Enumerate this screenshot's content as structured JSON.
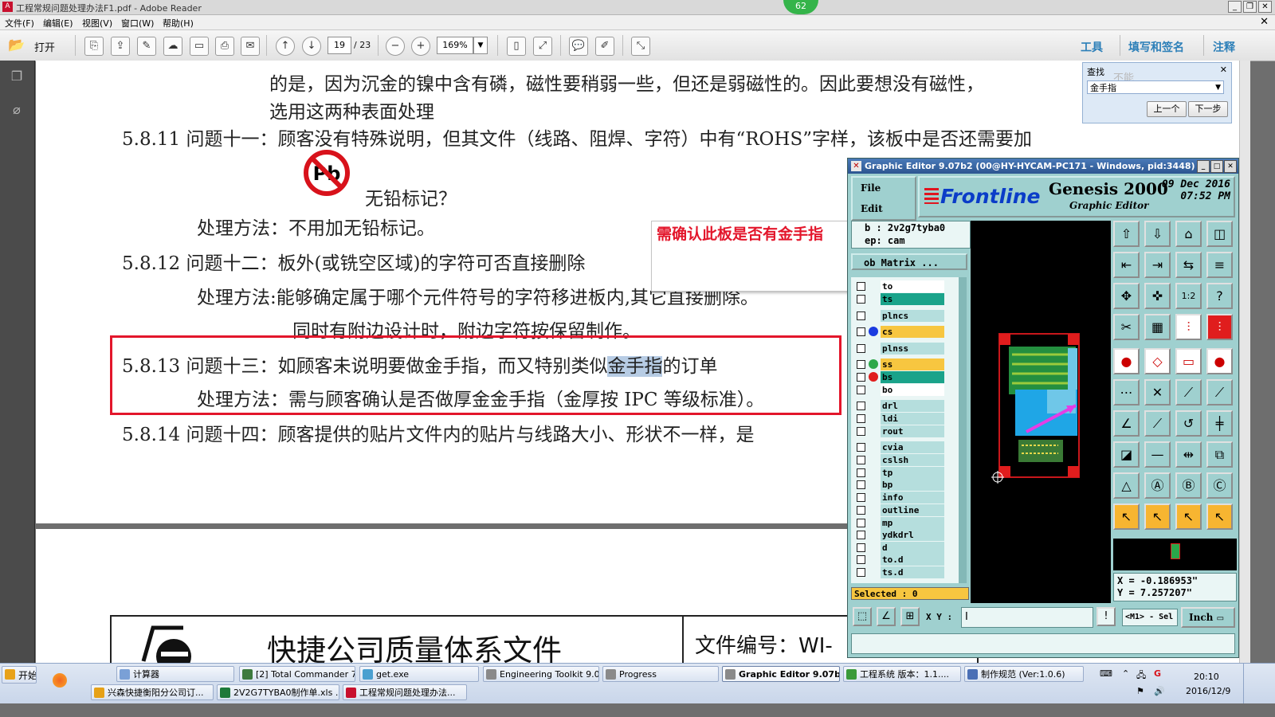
{
  "window": {
    "title": "工程常规问题处理办法F1.pdf - Adobe Reader",
    "badge": "62"
  },
  "menu": [
    "文件(F)",
    "编辑(E)",
    "视图(V)",
    "窗口(W)",
    "帮助(H)"
  ],
  "toolbar": {
    "open_label": "打开",
    "page_current": "19",
    "page_total": "/ 23",
    "zoom": "169%",
    "tools_label": "工具",
    "sign_label": "填写和签名",
    "comment_label": "注释"
  },
  "document": {
    "lines": [
      "的是，因为沉金的镍中含有磷，磁性要稍弱一些，但还是弱磁性的。因此要想没有磁性，",
      "选用这两种表面处理",
      "5.8.11 问题十一：顾客没有特殊说明，但其文件（线路、阻焊、字符）中有“ROHS”字样，该板中是否还需要加",
      "无铅标记？",
      "处理方法：不用加无铅标记。",
      "5.8.12 问题十二：板外(或铣空区域)的字符可否直接删除",
      "处理方法:能够确定属于哪个元件符号的字符移进板内,其它直接删除。",
      "同时有附边设计时，附边字符按保留制作。",
      "5.8.14 问题十四：顾客提供的贴片文件内的贴片与线路大小、形状不一样，是"
    ],
    "q13_prefix": "5.8.13 问题十三：如顾客未说明要做金手指，而又特别类似",
    "q13_highlight": "金手指",
    "q13_suffix": "的订单",
    "q13_method": "处理方法：需与顾客确认是否做厚金金手指（金厚按 IPC 等级标准）。",
    "footer_title": "快捷公司质量体系文件",
    "footer_docno": "文件编号：WI-",
    "pb_symbol": "Pb"
  },
  "annotation": {
    "text": "需确认此板是否有金手指"
  },
  "find": {
    "label": "查找",
    "value": "金手指",
    "ghost": "不能",
    "prev": "上一个",
    "next": "下一步"
  },
  "graphic_editor": {
    "title": "Graphic Editor 9.07b2 (00@HY-HYCAM-PC171 - Windows, pid:3448)",
    "menu": [
      "File",
      "Edit"
    ],
    "brand": "Frontline",
    "product": "Genesis 2000",
    "subtitle": "Graphic Editor",
    "date": "09 Dec 2016",
    "time": "07:52 PM",
    "job": "b  : 2v2g7tyba0",
    "step": "ep: cam",
    "matrix": "ob Matrix ...",
    "layers": [
      {
        "name": "to",
        "color": "#ffffff",
        "dot": ""
      },
      {
        "name": "ts",
        "color": "#1aa38a",
        "dot": ""
      },
      {
        "name": "plncs",
        "color": "#b5dedd",
        "dot": ""
      },
      {
        "name": "cs",
        "color": "#f7c640",
        "dot": "#1a3be0"
      },
      {
        "name": "plnss",
        "color": "#b5dedd",
        "dot": ""
      },
      {
        "name": "ss",
        "color": "#f7c640",
        "dot": "#2ea84a"
      },
      {
        "name": "bs",
        "color": "#1aa38a",
        "dot": "#e01d1d"
      },
      {
        "name": "bo",
        "color": "#ffffff",
        "dot": ""
      },
      {
        "name": "drl",
        "color": "#b5dedd",
        "dot": ""
      },
      {
        "name": "ldi",
        "color": "#b5dedd",
        "dot": ""
      },
      {
        "name": "rout",
        "color": "#b5dedd",
        "dot": ""
      },
      {
        "name": "cvia",
        "color": "#b5dedd",
        "dot": ""
      },
      {
        "name": "cslsh",
        "color": "#b5dedd",
        "dot": ""
      },
      {
        "name": "tp",
        "color": "#b5dedd",
        "dot": ""
      },
      {
        "name": "bp",
        "color": "#b5dedd",
        "dot": ""
      },
      {
        "name": "info",
        "color": "#b5dedd",
        "dot": ""
      },
      {
        "name": "outline",
        "color": "#b5dedd",
        "dot": ""
      },
      {
        "name": "mp",
        "color": "#b5dedd",
        "dot": ""
      },
      {
        "name": "ydkdrl",
        "color": "#b5dedd",
        "dot": ""
      },
      {
        "name": "d",
        "color": "#b5dedd",
        "dot": ""
      },
      {
        "name": "to.d",
        "color": "#b5dedd",
        "dot": ""
      },
      {
        "name": "ts.d",
        "color": "#b5dedd",
        "dot": ""
      }
    ],
    "selected": "Selected : 0",
    "coord_x": "X  = -0.186953\"",
    "coord_y": "Y  = 7.257207\"",
    "xy_label": "X Y :",
    "xy_value": "I",
    "mode": "<M1> - Sel",
    "unit": "Inch",
    "icons": [
      "layer-up-icon",
      "layer-down-icon",
      "home-icon",
      "window-icon",
      "zoom-out-left-icon",
      "zoom-in-right-icon",
      "pan-icon",
      "snap-icon",
      "fit-icon",
      "center-icon",
      "ratio-icon",
      "help-icon",
      "ruler-icon",
      "grid-icon",
      "feature-icon",
      "select-box-icon",
      "circle-icon",
      "shape-icon",
      "measure-icon",
      "point-icon",
      "link-icon",
      "cross-icon",
      "line-icon",
      "connect-icon",
      "angle-icon",
      "slash-icon",
      "arc-icon",
      "flag-icon",
      "pad-icon",
      "minus-icon",
      "dimension-icon",
      "copy-icon",
      "triangle-icon",
      "triangle-a-icon",
      "triangle-b-icon",
      "triangle-c-icon",
      "arrow-icon",
      "arrow-select-icon",
      "arrow-move-icon",
      "arrow-edit-icon"
    ]
  },
  "taskbar": {
    "start": "开始",
    "row1": [
      {
        "label": "计算器",
        "active": false
      },
      {
        "label": "[2] Total Commander 7....",
        "active": false
      },
      {
        "label": "get.exe",
        "active": false
      },
      {
        "label": "Engineering Toolkit 9.0....",
        "active": false
      },
      {
        "label": "Progress",
        "active": false
      },
      {
        "label": "Graphic Editor 9.07b...",
        "active": true
      },
      {
        "label": "工程系统  版本：1.1....",
        "active": false
      },
      {
        "label": "制作规范 (Ver:1.0.6)",
        "active": false
      }
    ],
    "row2": [
      {
        "label": "兴森快捷衡阳分公司订...",
        "active": false
      },
      {
        "label": "2V2G7TYBA0制作单.xls ...",
        "active": false
      },
      {
        "label": "工程常规问题处理办法...",
        "active": false
      }
    ],
    "clock_time": "20:10",
    "clock_date": "2016/12/9"
  }
}
